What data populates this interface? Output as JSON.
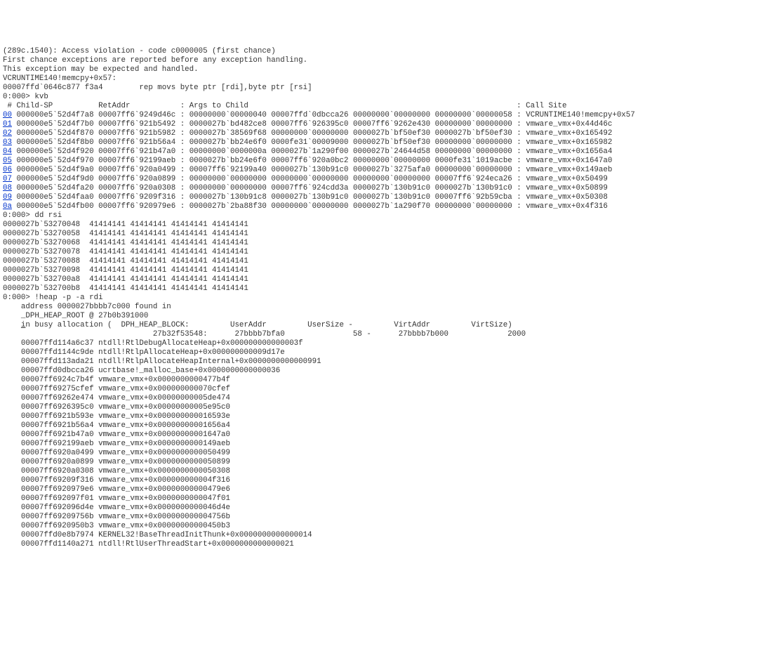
{
  "exception": {
    "header": "(289c.1540): Access violation - code c0000005 (first chance)",
    "note1": "First chance exceptions are reported before any exception handling.",
    "note2": "This exception may be expected and handled.",
    "frame_sym": "VCRUNTIME140!memcpy+0x57:",
    "frame_addr": "00007ffd`0646c877 f3a4",
    "frame_instr": "rep movs byte ptr [rdi],byte ptr [rsi]"
  },
  "prompts": {
    "p0": "0:000> kvb",
    "p1": "0:000> dd rsi",
    "p2": "0:000> !heap -p -a rdi"
  },
  "stack_header": {
    "prefix": " # Child-SP          RetAddr           : Args to Child                                                           : Call Site",
    "idx_prefix_spaces": ""
  },
  "stack": [
    {
      "idx": "00",
      "sp": "000000e5`52d4f7a8",
      "ret": "00007ff6`9249d46c",
      "args": [
        "00000000`00000040",
        "00007ffd`0dbcca26",
        "00000000`00000000",
        "00000000`00000058"
      ],
      "site": "VCRUNTIME140!memcpy+0x57"
    },
    {
      "idx": "01",
      "sp": "000000e5`52d4f7b0",
      "ret": "00007ff6`921b5492",
      "args": [
        "0000027b`bd482ce8",
        "00007ff6`926395c0",
        "00007ff6`9262e430",
        "00000000`00000000"
      ],
      "site": "vmware_vmx+0x44d46c"
    },
    {
      "idx": "02",
      "sp": "000000e5`52d4f870",
      "ret": "00007ff6`921b5982",
      "args": [
        "0000027b`38569f68",
        "00000000`00000000",
        "0000027b`bf50ef30",
        "0000027b`bf50ef30"
      ],
      "site": "vmware_vmx+0x165492"
    },
    {
      "idx": "03",
      "sp": "000000e5`52d4f8b0",
      "ret": "00007ff6`921b56a4",
      "args": [
        "0000027b`bb24e6f0",
        "0000fe31`00009000",
        "0000027b`bf50ef30",
        "00000000`00000000"
      ],
      "site": "vmware_vmx+0x165982"
    },
    {
      "idx": "04",
      "sp": "000000e5`52d4f920",
      "ret": "00007ff6`921b47a0",
      "args": [
        "00000000`0000000a",
        "0000027b`1a290f00",
        "0000027b`24644d58",
        "00000000`00000000"
      ],
      "site": "vmware_vmx+0x1656a4"
    },
    {
      "idx": "05",
      "sp": "000000e5`52d4f970",
      "ret": "00007ff6`92199aeb",
      "args": [
        "0000027b`bb24e6f0",
        "00007ff6`920a0bc2",
        "00000000`00000000",
        "0000fe31`1019acbe"
      ],
      "site": "vmware_vmx+0x1647a0"
    },
    {
      "idx": "06",
      "sp": "000000e5`52d4f9a0",
      "ret": "00007ff6`920a0499",
      "args": [
        "00007ff6`92199a40",
        "0000027b`130b91c0",
        "0000027b`3275afa0",
        "00000000`00000000"
      ],
      "site": "vmware_vmx+0x149aeb"
    },
    {
      "idx": "07",
      "sp": "000000e5`52d4f9d0",
      "ret": "00007ff6`920a0899",
      "args": [
        "00000000`00000000",
        "00000000`00000000",
        "00000000`00000000",
        "00007ff6`924eca26"
      ],
      "site": "vmware_vmx+0x50499"
    },
    {
      "idx": "08",
      "sp": "000000e5`52d4fa20",
      "ret": "00007ff6`920a0308",
      "args": [
        "00000000`00000000",
        "00007ff6`924cdd3a",
        "0000027b`130b91c0",
        "0000027b`130b91c0"
      ],
      "site": "vmware_vmx+0x50899"
    },
    {
      "idx": "09",
      "sp": "000000e5`52d4faa0",
      "ret": "00007ff6`9209f316",
      "args": [
        "0000027b`130b91c8",
        "0000027b`130b91c0",
        "0000027b`130b91c0",
        "00007ff6`92b59cba"
      ],
      "site": "vmware_vmx+0x50308"
    },
    {
      "idx": "0a",
      "sp": "000000e5`52d4fb00",
      "ret": "00007ff6`920979e6",
      "args": [
        "0000027b`2ba88f30",
        "00000000`00000000",
        "0000027b`1a290f70",
        "00000000`00000000"
      ],
      "site": "vmware_vmx+0x4f316"
    }
  ],
  "dd": [
    {
      "addr": "0000027b`53270048",
      "vals": [
        "41414141",
        "41414141",
        "41414141",
        "41414141"
      ]
    },
    {
      "addr": "0000027b`53270058",
      "vals": [
        "41414141",
        "41414141",
        "41414141",
        "41414141"
      ]
    },
    {
      "addr": "0000027b`53270068",
      "vals": [
        "41414141",
        "41414141",
        "41414141",
        "41414141"
      ]
    },
    {
      "addr": "0000027b`53270078",
      "vals": [
        "41414141",
        "41414141",
        "41414141",
        "41414141"
      ]
    },
    {
      "addr": "0000027b`53270088",
      "vals": [
        "41414141",
        "41414141",
        "41414141",
        "41414141"
      ]
    },
    {
      "addr": "0000027b`53270098",
      "vals": [
        "41414141",
        "41414141",
        "41414141",
        "41414141"
      ]
    },
    {
      "addr": "0000027b`532700a8",
      "vals": [
        "41414141",
        "41414141",
        "41414141",
        "41414141"
      ]
    },
    {
      "addr": "0000027b`532700b8",
      "vals": [
        "41414141",
        "41414141",
        "41414141",
        "41414141"
      ]
    }
  ],
  "heap": {
    "line1": "    address 0000027bbbb7c000 found in",
    "line2": "    _DPH_HEAP_ROOT @ 27b0b391000",
    "line3_a": "    in busy allocation (  DPH_HEAP_BLOCK:         UserAddr         UserSize -         VirtAddr         VirtSize)",
    "line3_u": "i",
    "line4": "                                 27b32f53548:      27bbbb7bfa0               58 -      27bbbb7b000             2000",
    "trace": [
      "    00007ffd114a6c37 ntdll!RtlDebugAllocateHeap+0x000000000000003f",
      "    00007ffd1144c9de ntdll!RtlpAllocateHeap+0x000000000009d17e",
      "    00007ffd113ada21 ntdll!RtlpAllocateHeapInternal+0x0000000000000991",
      "    00007ffd0dbcca26 ucrtbase!_malloc_base+0x0000000000000036",
      "    00007ff6924c7b4f vmware_vmx+0x0000000000477b4f",
      "    00007ff69275cfef vmware_vmx+0x000000000070cfef",
      "    00007ff69262e474 vmware_vmx+0x00000000005de474",
      "    00007ff6926395c0 vmware_vmx+0x00000000005e95c0",
      "    00007ff6921b593e vmware_vmx+0x000000000016593e",
      "    00007ff6921b56a4 vmware_vmx+0x00000000001656a4",
      "    00007ff6921b47a0 vmware_vmx+0x00000000001647a0",
      "    00007ff692199aeb vmware_vmx+0x0000000000149aeb",
      "    00007ff6920a0499 vmware_vmx+0x0000000000050499",
      "    00007ff6920a0899 vmware_vmx+0x0000000000050899",
      "    00007ff6920a0308 vmware_vmx+0x0000000000050308",
      "    00007ff69209f316 vmware_vmx+0x000000000004f316",
      "    00007ff6920979e6 vmware_vmx+0x00000000000479e6",
      "    00007ff692097f01 vmware_vmx+0x0000000000047f01",
      "    00007ff692096d4e vmware_vmx+0x0000000000046d4e",
      "    00007ff69209756b vmware_vmx+0x000000000004756b",
      "    00007ff6920950b3 vmware_vmx+0x00000000000450b3",
      "    00007ffd0e8b7974 KERNEL32!BaseThreadInitThunk+0x0000000000000014",
      "    00007ffd1140a271 ntdll!RtlUserThreadStart+0x0000000000000021"
    ]
  }
}
